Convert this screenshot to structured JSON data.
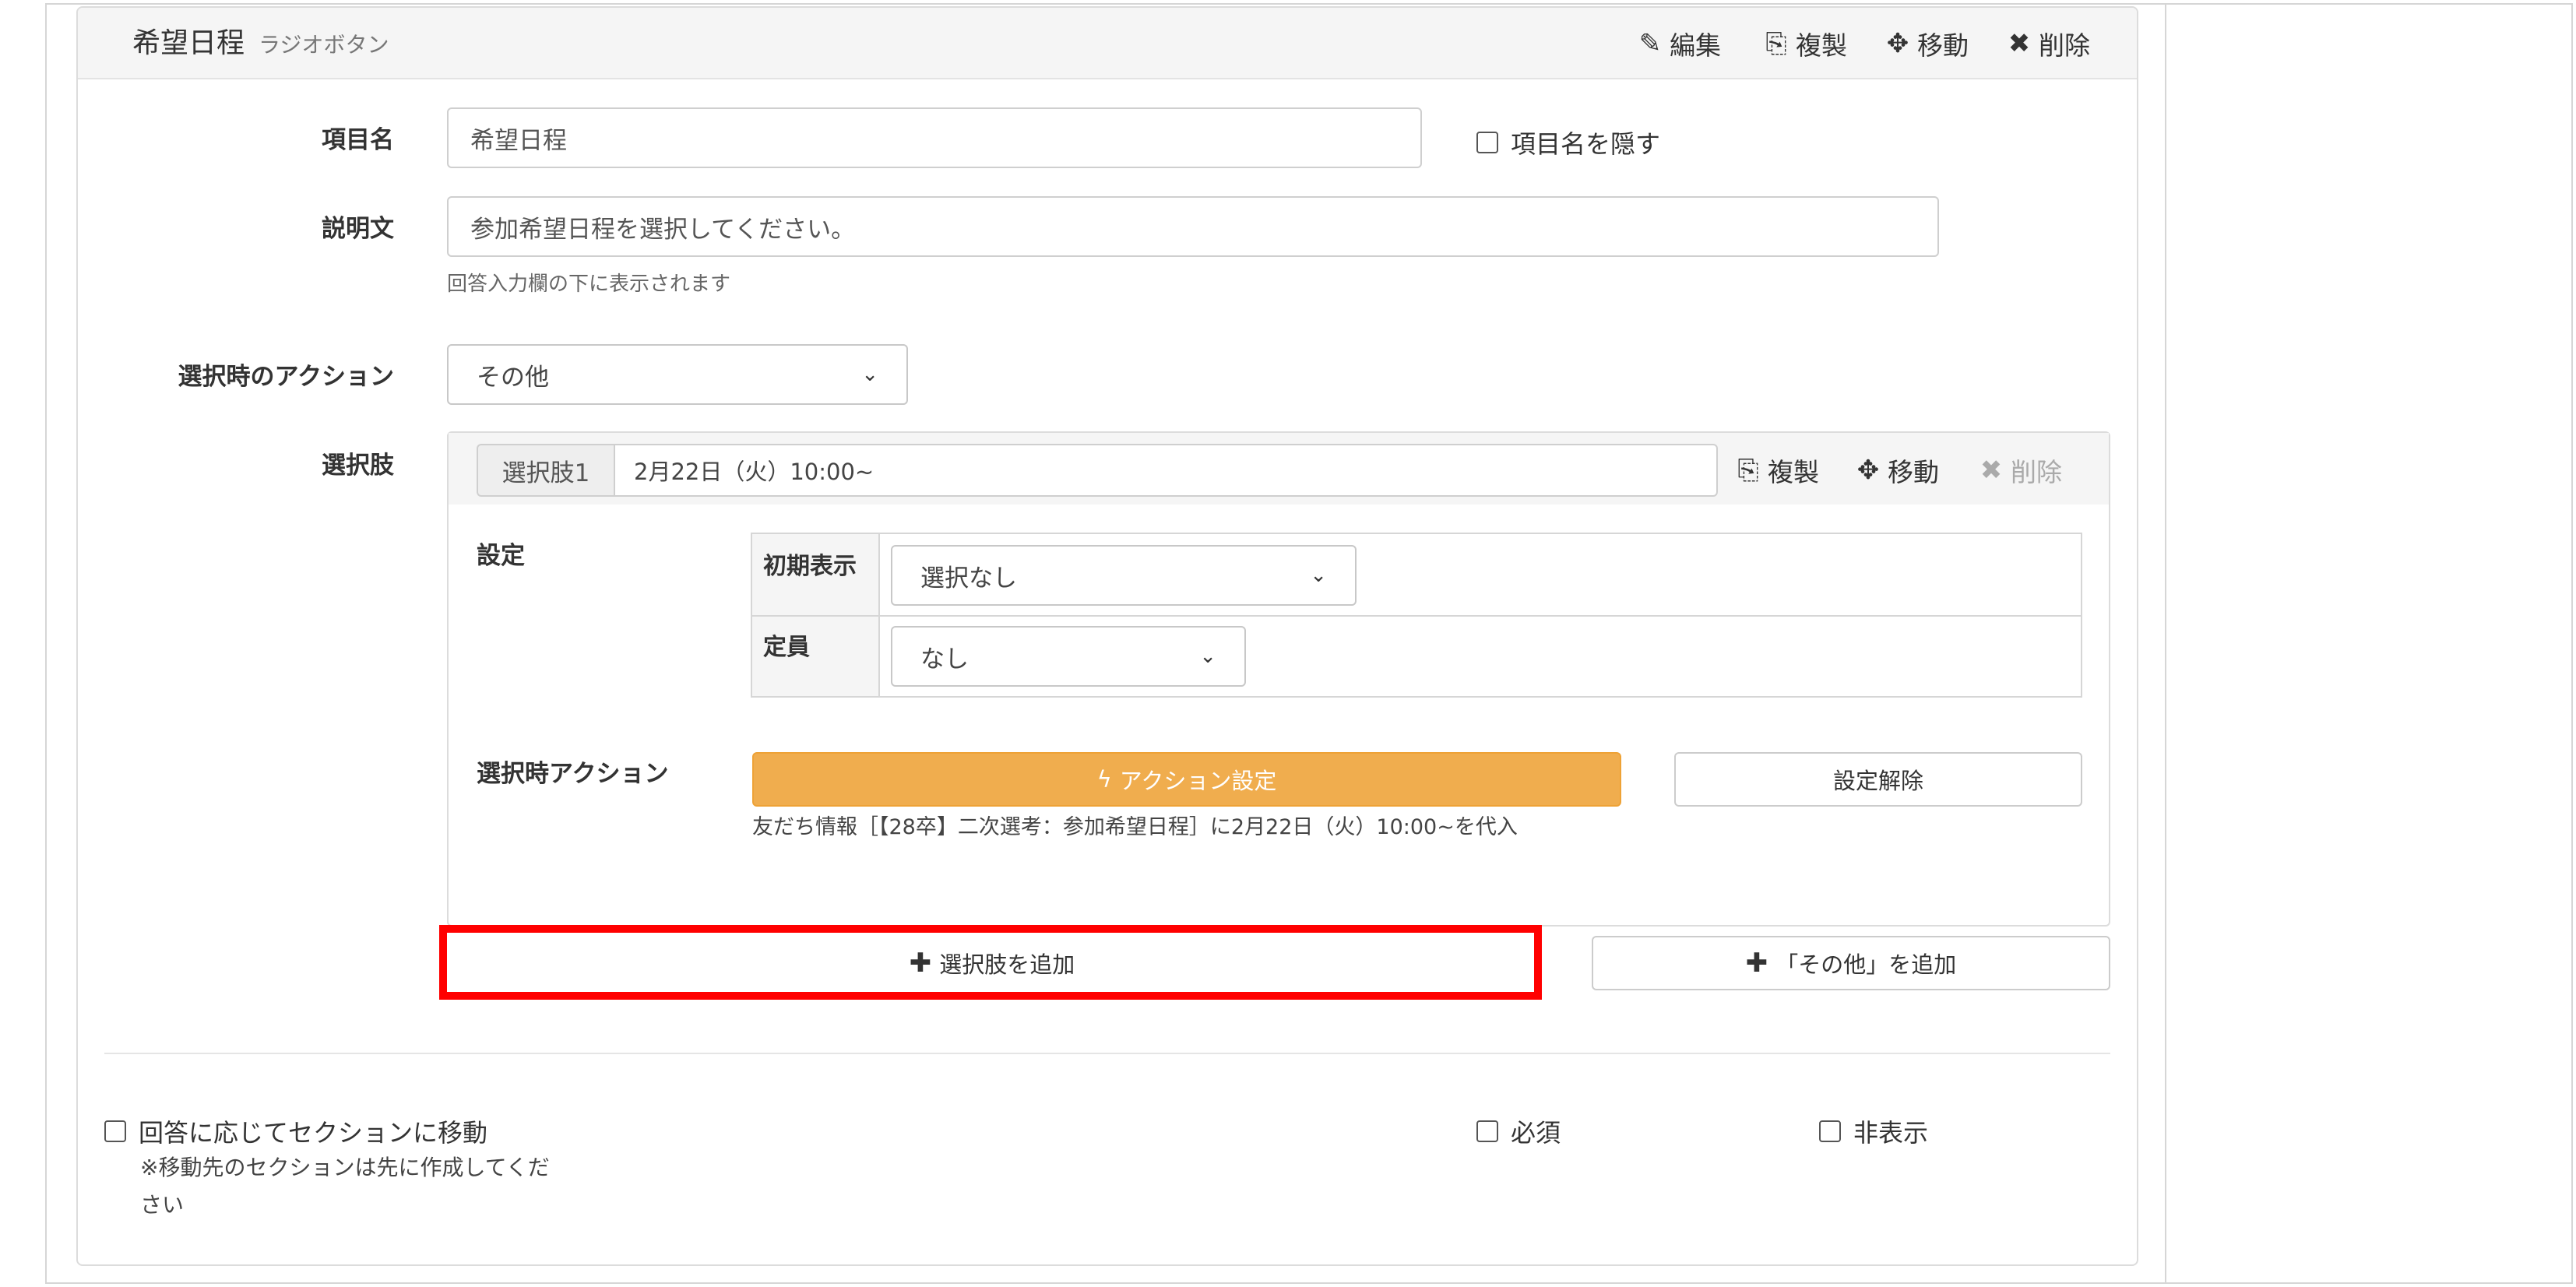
{
  "header": {
    "title": "希望日程",
    "subtitle": "ラジオボタン",
    "actions": {
      "edit": "編集",
      "copy": "複製",
      "move": "移動",
      "delete": "削除"
    }
  },
  "form": {
    "item_name_label": "項目名",
    "item_name_value": "希望日程",
    "hide_name_label": "項目名を隠す",
    "description_label": "説明文",
    "description_value": "参加希望日程を選択してください。",
    "description_help": "回答入力欄の下に表示されます",
    "select_action_label": "選択時のアクション",
    "select_action_value": "その他",
    "choices_label": "選択肢"
  },
  "choice": {
    "addon": "選択肢1",
    "value": "2月22日（火）10:00~",
    "actions": {
      "copy": "複製",
      "move": "移動",
      "delete": "削除"
    },
    "settings_label": "設定",
    "initial_display_label": "初期表示",
    "initial_display_value": "選択なし",
    "capacity_label": "定員",
    "capacity_value": "なし",
    "action_label": "選択時アクション",
    "action_button": "アクション設定",
    "clear_button": "設定解除",
    "action_info": "友だち情報［【28卒】二次選考：参加希望日程］に2月22日（火）10:00~を代入"
  },
  "buttons": {
    "add_choice": "選択肢を追加",
    "add_other": "「その他」を追加"
  },
  "footer": {
    "section_move_label": "回答に応じてセクションに移動",
    "section_move_note_line1": "※移動先のセクションは先に作成してくだ",
    "section_move_note_line2": "さい",
    "required_label": "必須",
    "hidden_label": "非表示"
  },
  "colors": {
    "accent_orange": "#f0ad4e",
    "highlight_red": "#ff0000"
  }
}
